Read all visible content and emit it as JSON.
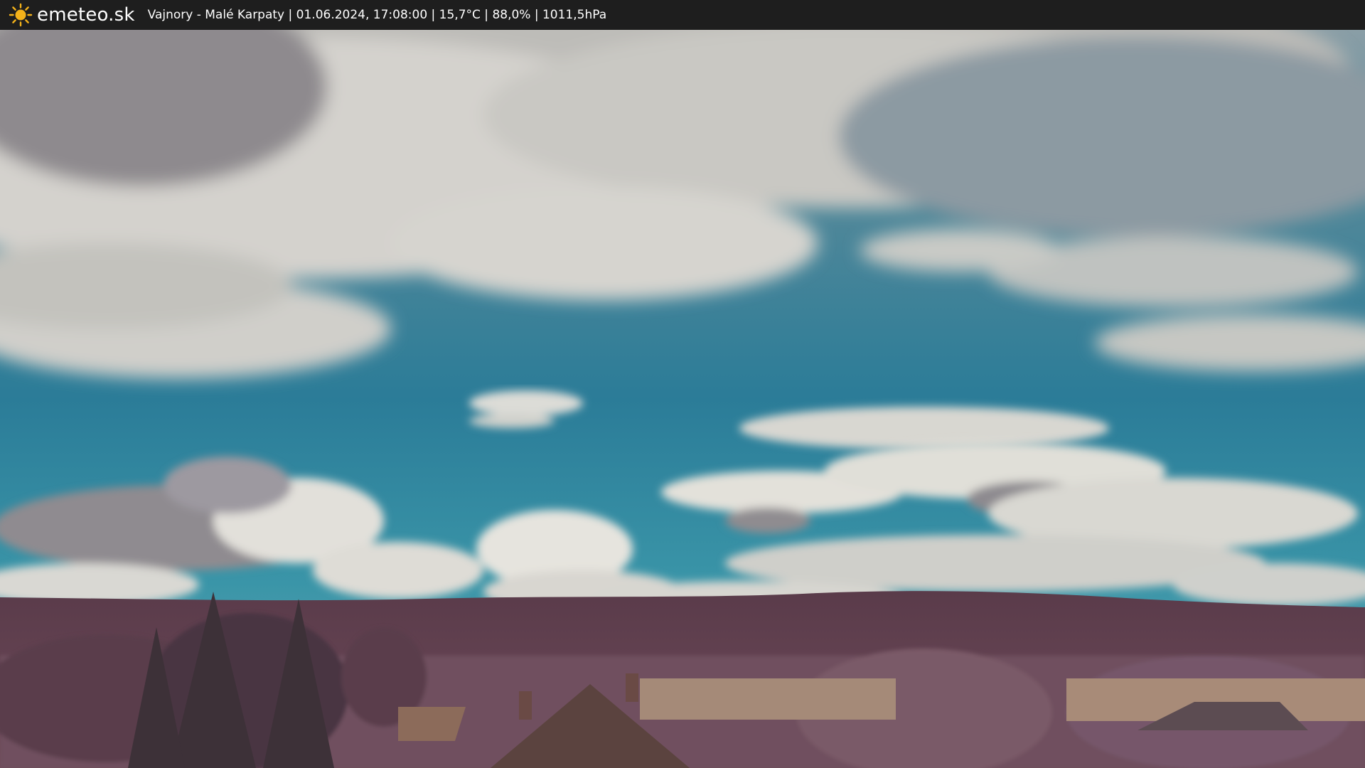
{
  "header": {
    "brand": "emeteo.sk",
    "caption": "Vajnory - Malé Karpaty | 01.06.2024, 17:08:00 | 15,7°C | 88,0% | 1011,5hPa",
    "logo_icon": "sun-icon"
  },
  "colors": {
    "topbar_bg": "#1e1e1e",
    "sky_top": "#6f8f9c",
    "sky_mid": "#2e7f9a",
    "sky_low": "#3a95a8",
    "cloud_light": "#e9e8e2",
    "cloud_shadow": "#8d8a8c",
    "hills": "#5f3f4e",
    "foliage": "#7b5a68",
    "field": "#a58a78",
    "roof": "#6a4a45",
    "sun": "#f4b21a"
  }
}
